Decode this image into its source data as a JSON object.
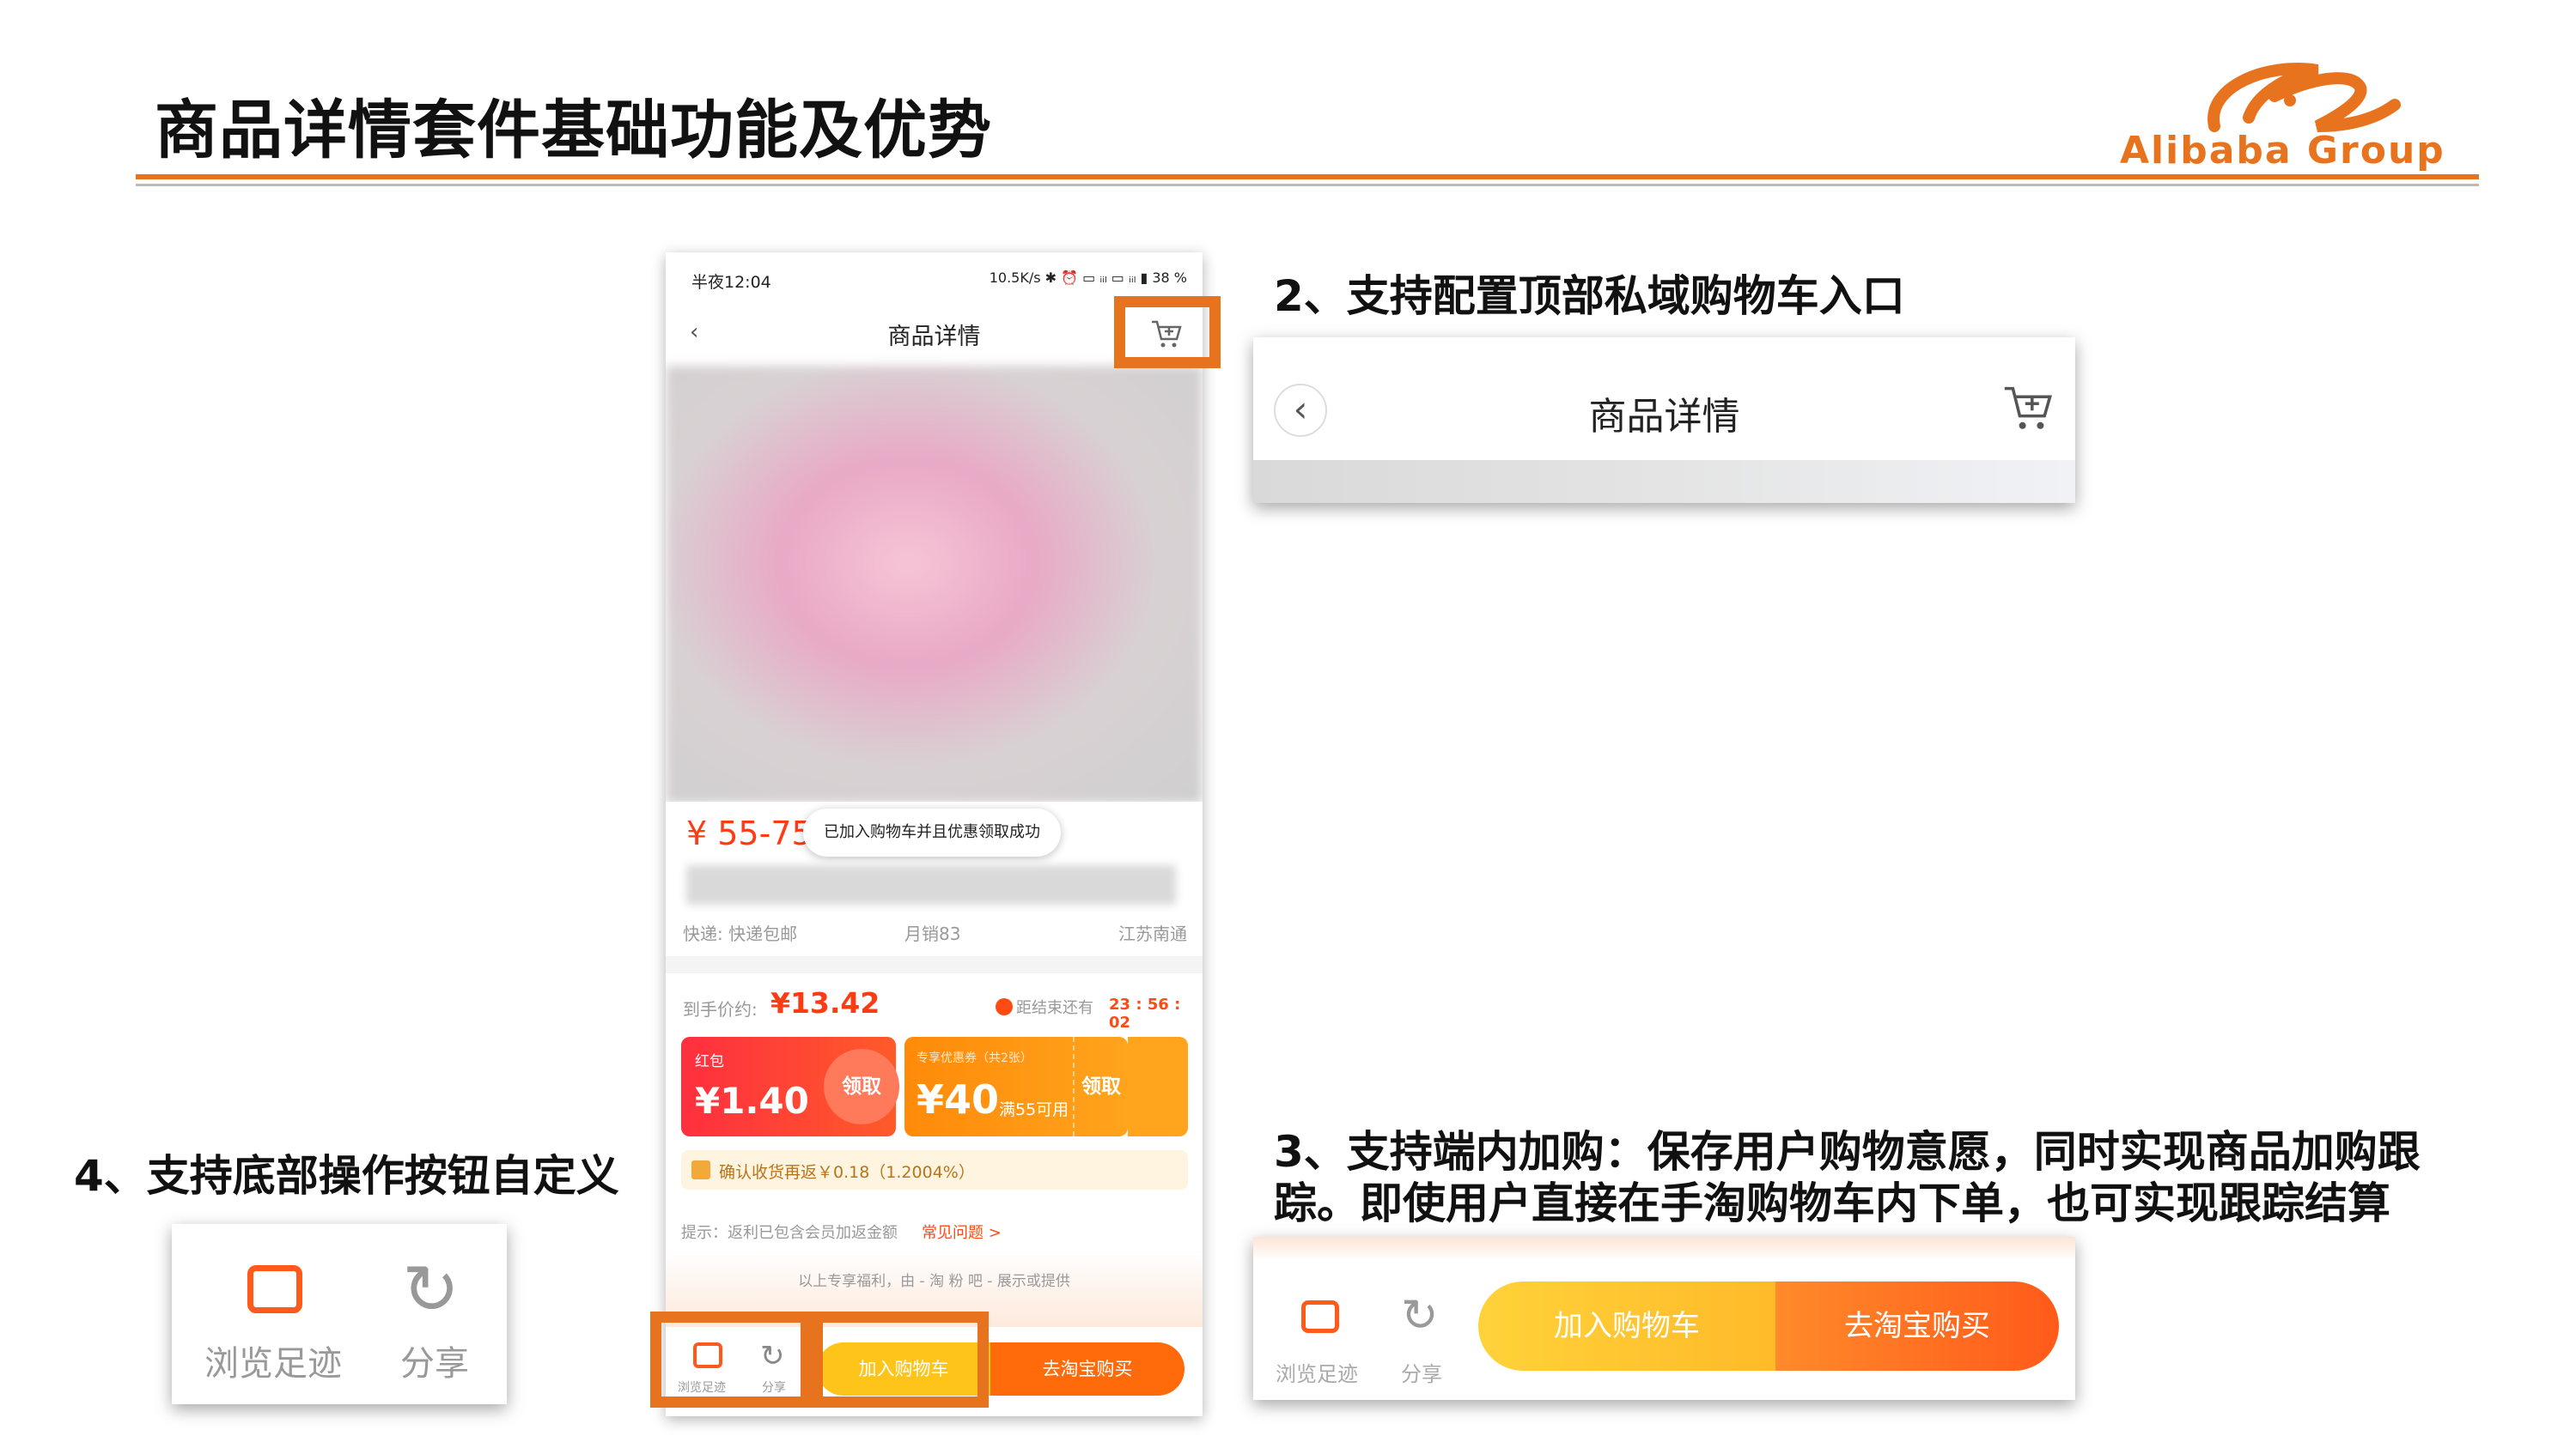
{
  "slide": {
    "title": "商品详情套件基础功能及优势",
    "logo_text": "Alibaba Group",
    "brand_color": "#e8731f"
  },
  "callouts": {
    "c2": "2、支持配置顶部私域购物车入口",
    "c3_line1": "3、支持端内加购：保存用户购物意愿，同时实现商品加购跟",
    "c3_line2": "踪。即使用户直接在手淘购物车内下单，也可实现跟踪结算",
    "c4": "4、支持底部操作按钮自定义"
  },
  "phone": {
    "status_time": "半夜12:04",
    "status_right": "10.5K/s ✱ ⏰ ▭ ᵢᵢₗ ▭ ᵢᵢₗ ▮ 38 %",
    "nav_title": "商品详情",
    "price_range": "¥ 55-75",
    "toast": "已加入购物车并且优惠领取成功",
    "shipping": "快递: 快递包邮",
    "monthly_sales": "月销83",
    "location": "江苏南通",
    "final_price_label": "到手价约:",
    "final_price": "¥13.42",
    "countdown_label": "距结束还有",
    "countdown": "23 : 56 : 02",
    "hongbao_label": "红包",
    "hongbao_value": "¥1.40",
    "claim": "领取",
    "coupon_label": "专享优惠券（共2张）",
    "coupon_value": "¥40",
    "coupon_cond": "满55可用",
    "rebate": "确认收货再返￥0.18（1.2004%）",
    "tip": "提示：返利已包含会员加返金额",
    "faq": "常见问题 >",
    "footer_note": "以上专享福利，由 - 淘 粉 吧 - 展示或提供",
    "browse": "浏览足迹",
    "share": "分享",
    "add_cart": "加入购物车",
    "buy": "去淘宝购买"
  },
  "zoom_top": {
    "title": "商品详情"
  },
  "zoom_bottom": {
    "browse": "浏览足迹",
    "share": "分享",
    "add_cart": "加入购物车",
    "buy": "去淘宝购买"
  },
  "zoom_left": {
    "browse": "浏览足迹",
    "share": "分享"
  }
}
